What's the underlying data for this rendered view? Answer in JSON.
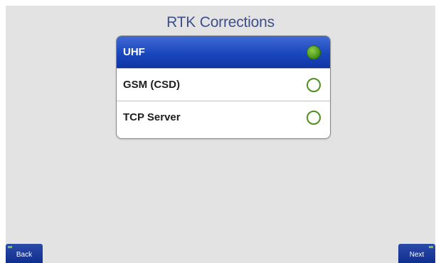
{
  "screen": {
    "title": "RTK Corrections"
  },
  "options": [
    {
      "label": "UHF",
      "selected": true
    },
    {
      "label": "GSM (CSD)",
      "selected": false
    },
    {
      "label": "TCP Server",
      "selected": false
    }
  ],
  "nav": {
    "back_label": "Back",
    "next_label": "Next"
  },
  "colors": {
    "selected_row": "#1a47bd",
    "title_text": "#3d4f8a",
    "radio_green": "#4e8f1f",
    "nav_button": "#0f2f8f",
    "background": "#e3e3e3"
  }
}
